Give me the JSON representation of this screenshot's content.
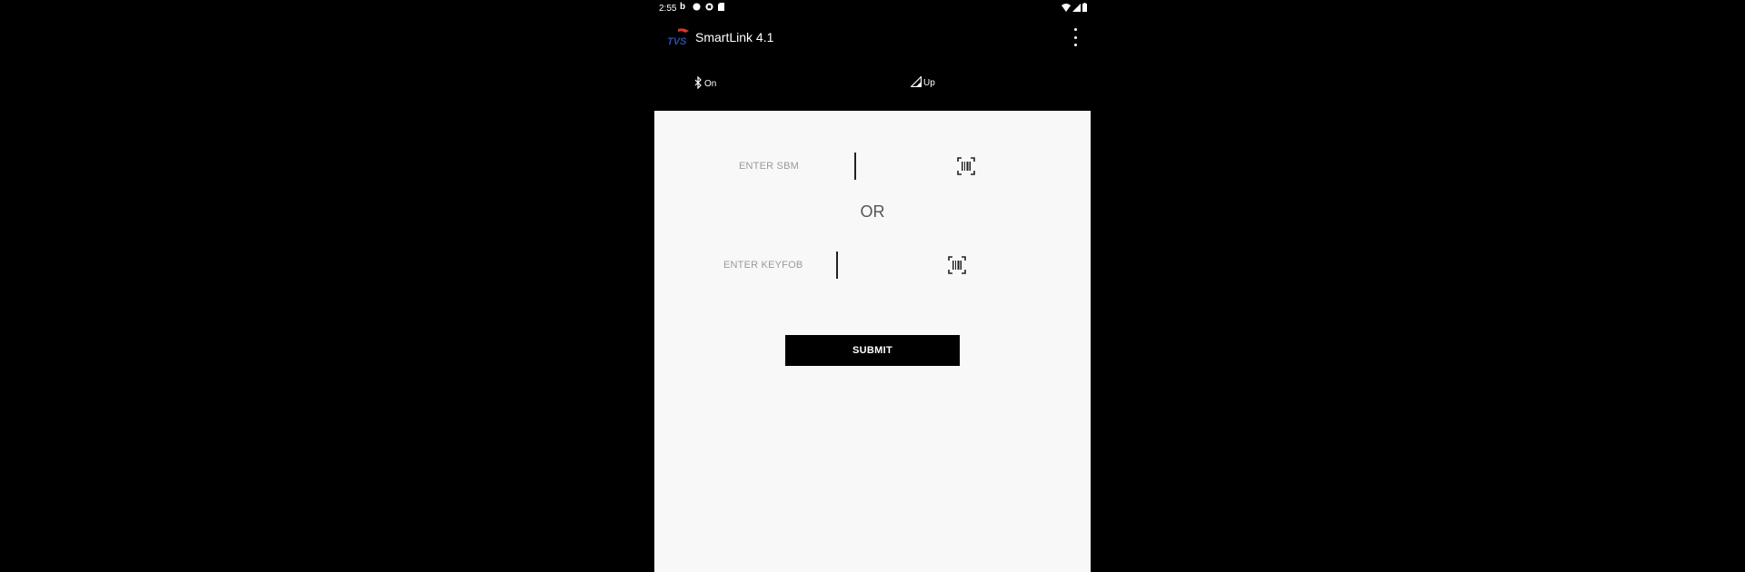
{
  "status_bar": {
    "time": "2:55",
    "left_icons": [
      "b-notification-icon",
      "circle-notification-icon",
      "media-notification-icon",
      "sd-card-icon"
    ],
    "right_icons": [
      "wifi-icon",
      "cellular-signal-icon",
      "battery-icon"
    ]
  },
  "app_bar": {
    "logo_text": "TVS",
    "title": "SmartLink 4.1",
    "menu_icon": "overflow-menu-icon"
  },
  "tabs": {
    "bluetooth_label": "On",
    "signal_label": "Up"
  },
  "form": {
    "sbm_placeholder": "ENTER SBM",
    "sbm_value": "",
    "or_label": "OR",
    "keyfob_placeholder": "ENTER KEYFOB",
    "keyfob_value": "",
    "submit_label": "SUBMIT"
  },
  "colors": {
    "app_background": "#000000",
    "content_background": "#f8f8f8",
    "button_background": "#000000",
    "placeholder_text": "#9a9a9a"
  }
}
